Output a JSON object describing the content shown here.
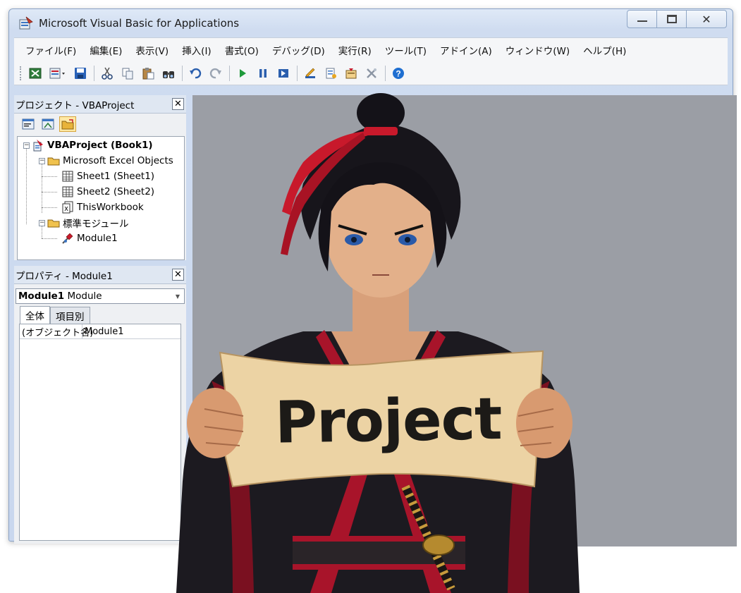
{
  "window": {
    "title": "Microsoft Visual Basic for Applications",
    "caption": {
      "minimize": "—",
      "maximize": "☐",
      "close": "✕"
    }
  },
  "menubar": {
    "items": [
      "ファイル(F)",
      "編集(E)",
      "表示(V)",
      "挿入(I)",
      "書式(O)",
      "デバッグ(D)",
      "実行(R)",
      "ツール(T)",
      "アドイン(A)",
      "ウィンドウ(W)",
      "ヘルプ(H)"
    ]
  },
  "toolbar": {
    "icons": [
      "excel-view-icon",
      "insert-module-icon",
      "save-icon",
      "cut-icon",
      "copy-icon",
      "paste-icon",
      "find-icon",
      "undo-icon",
      "redo-icon",
      "run-icon",
      "break-icon",
      "reset-icon",
      "design-mode-icon",
      "project-explorer-icon",
      "properties-window-icon",
      "toolbox-icon",
      "help-icon"
    ]
  },
  "project_panel": {
    "title": "プロジェクト - VBAProject",
    "close": "✕",
    "tree": {
      "root": "VBAProject (Book1)",
      "folder_objects": "Microsoft Excel Objects",
      "sheet1": "Sheet1 (Sheet1)",
      "sheet2": "Sheet2 (Sheet2)",
      "workbook": "ThisWorkbook",
      "folder_modules": "標準モジュール",
      "module1": "Module1"
    }
  },
  "properties_panel": {
    "title": "プロパティ - Module1",
    "close": "✕",
    "object_name": "Module1",
    "object_type": "Module",
    "tabs": [
      "全体",
      "項目別"
    ],
    "rows": [
      {
        "name": "(オブジェクト名)",
        "value": "Module1"
      }
    ]
  },
  "illustration": {
    "sign_text": "Project"
  },
  "colors": {
    "accent_ribbon": "#c8192b",
    "mdi_background": "#9b9ea5",
    "help_blue": "#1f6fd1"
  }
}
